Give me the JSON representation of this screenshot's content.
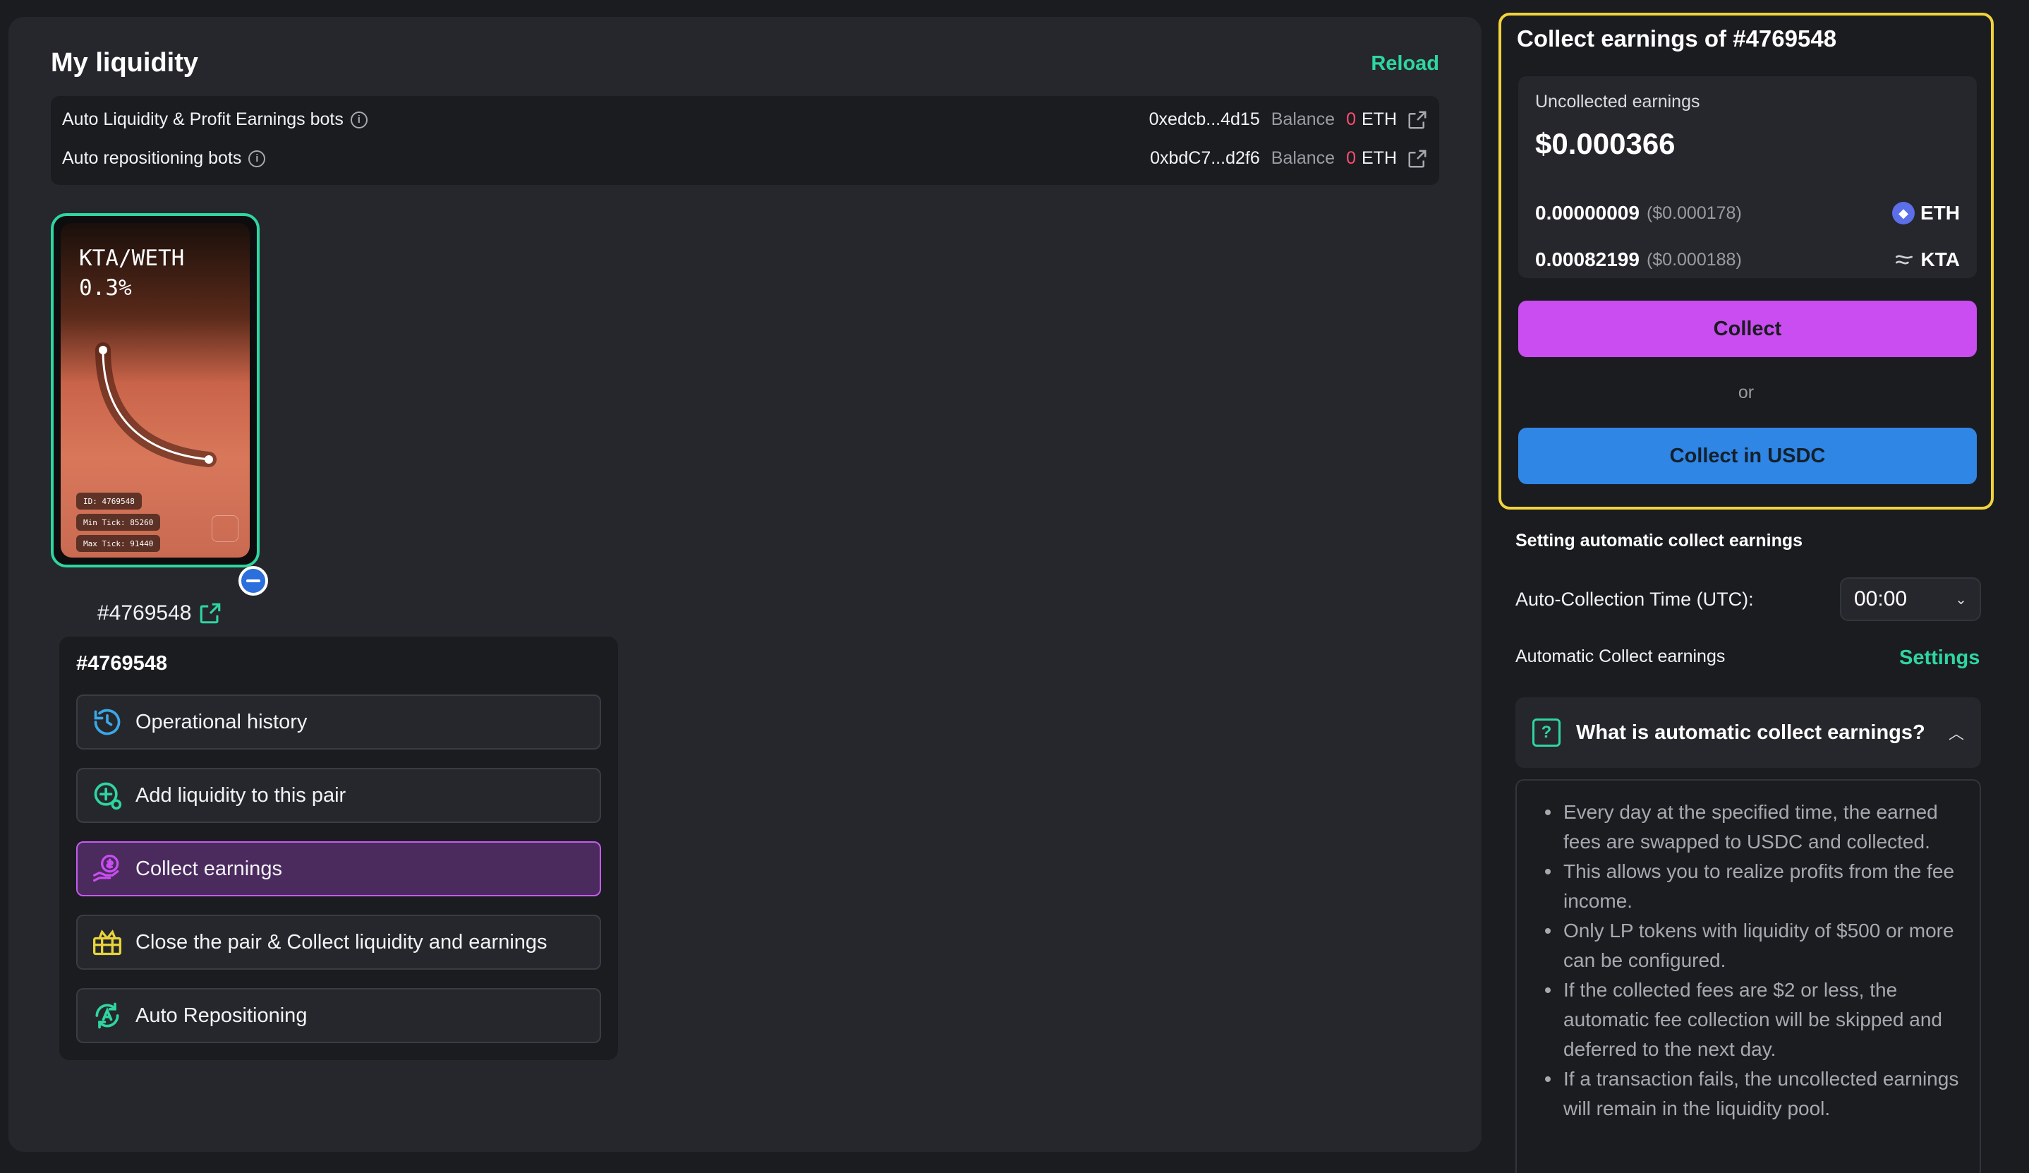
{
  "main": {
    "title": "My liquidity",
    "reload_label": "Reload",
    "bots": [
      {
        "name": "Auto Liquidity & Profit Earnings bots",
        "address": "0xedcb...4d15",
        "balance_label": "Balance",
        "balance_value": "0",
        "balance_unit": "ETH"
      },
      {
        "name": "Auto repositioning bots",
        "address": "0xbdC7...d2f6",
        "balance_label": "Balance",
        "balance_value": "0",
        "balance_unit": "ETH"
      }
    ],
    "nft": {
      "pair": "KTA/WETH",
      "fee": "0.3%",
      "tag_id": "ID: 4769548",
      "tag_min": "Min Tick: 85260",
      "tag_max": "Max Tick: 91440",
      "id_label": "#4769548"
    },
    "menu": {
      "title": "#4769548",
      "items": [
        {
          "label": "Operational history"
        },
        {
          "label": "Add liquidity to this pair"
        },
        {
          "label": "Collect earnings"
        },
        {
          "label": "Close the pair & Collect liquidity and earnings"
        },
        {
          "label": "Auto Repositioning"
        }
      ]
    }
  },
  "collect": {
    "title": "Collect earnings of #4769548",
    "uncollected_label": "Uncollected earnings",
    "total": "$0.000366",
    "tokens": [
      {
        "amount": "0.00000009",
        "usd": "($0.000178)",
        "symbol": "ETH"
      },
      {
        "amount": "0.00082199",
        "usd": "($0.000188)",
        "symbol": "KTA"
      }
    ],
    "collect_label": "Collect",
    "or_label": "or",
    "collect_usdc_label": "Collect in USDC"
  },
  "auto": {
    "title": "Setting automatic collect earnings",
    "time_label": "Auto-Collection Time (UTC):",
    "time_value": "00:00",
    "auto_label": "Automatic Collect earnings",
    "settings_label": "Settings",
    "faq_title": "What is automatic collect earnings?",
    "faq_items": [
      "Every day at the specified time, the earned fees are swapped to USDC and collected.",
      "This allows you to realize profits from the fee income.",
      "Only LP tokens with liquidity of $500 or more can be configured.",
      "If the collected fees are $2 or less, the automatic fee collection will be skipped and deferred to the next day.",
      "If a transaction fails, the uncollected earnings will remain in the liquidity pool."
    ]
  },
  "colors": {
    "accent_green": "#2ed6a0",
    "collect_purple": "#c94df0",
    "usdc_blue": "#2f86e4",
    "highlight_yellow": "#f2d33b",
    "balance_red": "#ff4d6d"
  }
}
